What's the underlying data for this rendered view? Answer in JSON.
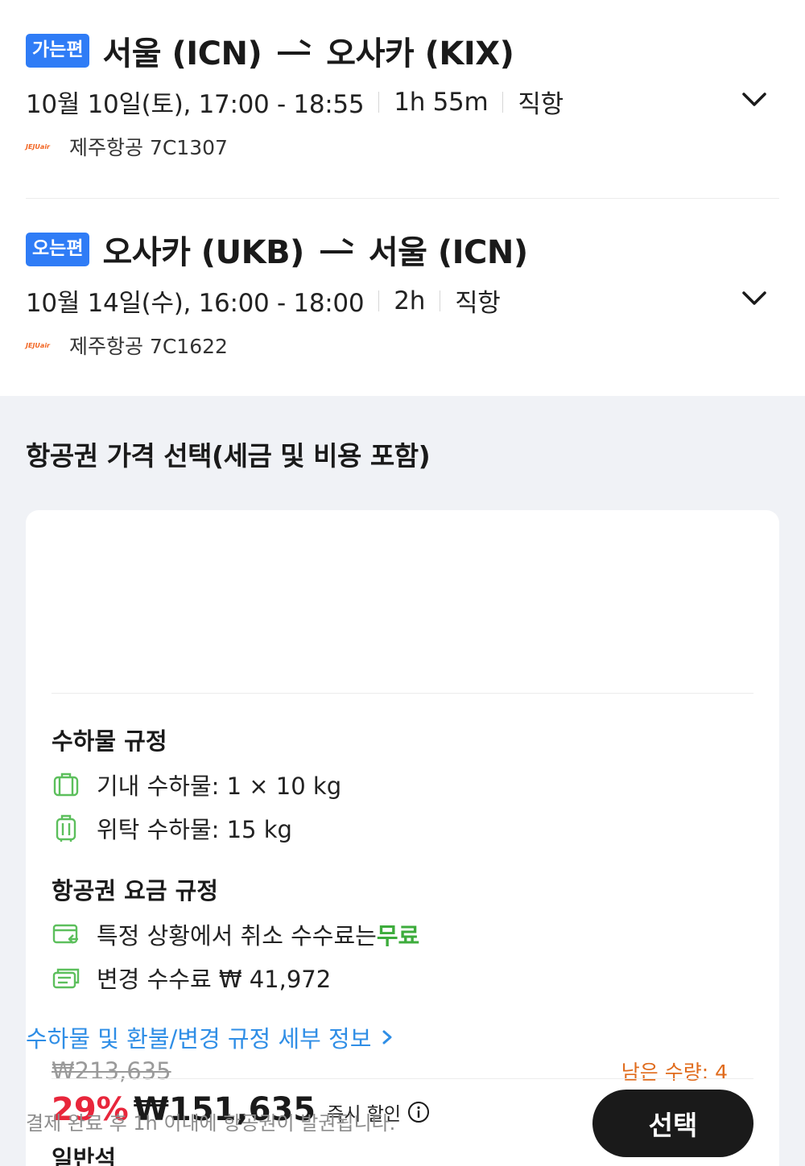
{
  "outbound": {
    "badge": "가는편",
    "from": "서울 (ICN)",
    "to": "오사카 (KIX)",
    "date_time": "10월 10일(토), 17:00 - 18:55",
    "duration": "1h 55m",
    "stops": "직항",
    "airline_logo_text": "JEJUair",
    "airline": "제주항공 7C1307"
  },
  "return": {
    "badge": "오는편",
    "from": "오사카 (UKB)",
    "to": "서울 (ICN)",
    "date_time": "10월 14일(수), 16:00 - 18:00",
    "duration": "2h",
    "stops": "직항",
    "airline_logo_text": "JEJUair",
    "airline": "제주항공 7C1622"
  },
  "price_section": {
    "title": "항공권 가격 선택(세금 및 비용 포함)"
  },
  "fare": {
    "original_price": "₩213,635",
    "remaining": "남은 수량: 4",
    "discount": "29%",
    "price": "₩151,635",
    "instant_label": "즉시 할인",
    "seat_class": "일반석",
    "select_label": "선택"
  },
  "baggage": {
    "title": "수하물 규정",
    "carry_on": "기내 수하물: 1 × 10 kg",
    "checked": "위탁 수하물: 15 kg"
  },
  "fare_rules": {
    "title": "항공권 요금 규정",
    "cancel_prefix": "특정 상황에서 취소 수수료는 ",
    "cancel_free": "무료",
    "change_fee": "변경 수수료 ₩ 41,972"
  },
  "detail_link": "수하물 및 환불/변경 규정 세부 정보",
  "footer_note": "결제 완료 후 1h 이내에 항공권이 발권됩니다.",
  "colors": {
    "badge_blue": "#2f7cf6",
    "discount_red": "#e8263b",
    "remaining_orange": "#e06b1c",
    "free_green": "#3dac3c",
    "link_blue": "#2f8ee6",
    "icon_green": "#5cbf5c"
  },
  "icons": {
    "expand": "chevron-down-icon",
    "info": "info-icon",
    "carry_on": "carry-on-bag-icon",
    "checked": "checked-bag-icon",
    "cancel": "refund-card-icon",
    "change": "change-ticket-icon",
    "link_arrow": "chevron-right-icon"
  }
}
